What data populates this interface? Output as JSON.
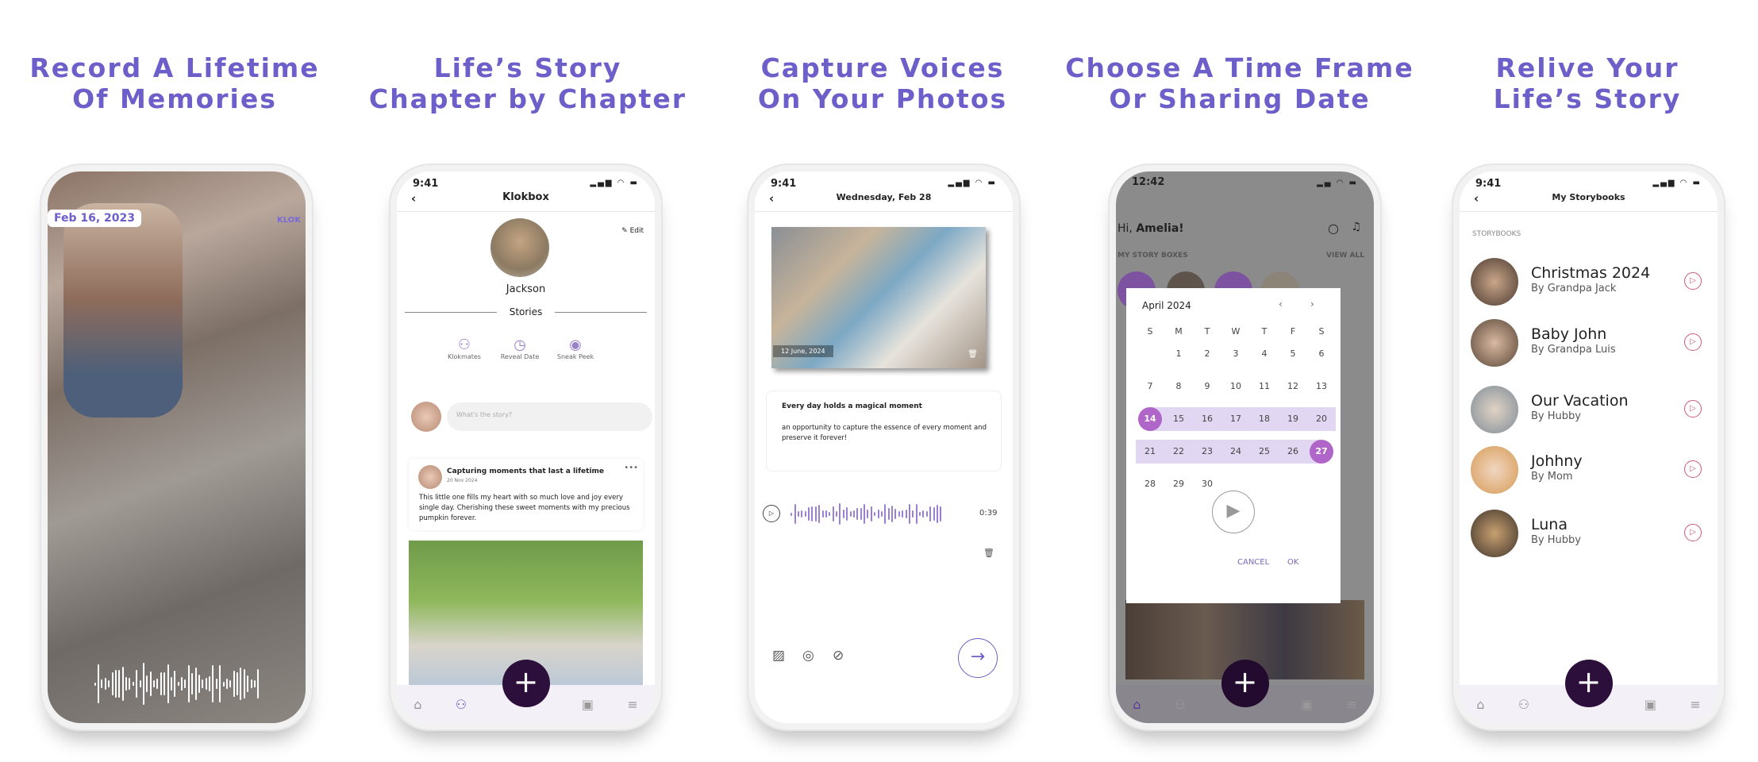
{
  "headlines": [
    {
      "line1": "Record A Lifetime",
      "line2": "Of Memories"
    },
    {
      "line1": "Life’s Story",
      "line2": "Chapter by Chapter"
    },
    {
      "line1": "Capture Voices",
      "line2": "On Your Photos"
    },
    {
      "line1": "Choose A Time Frame",
      "line2": "Or Sharing Date"
    },
    {
      "line1": "Relive Your",
      "line2": "Life’s Story"
    }
  ],
  "colors": {
    "headline": "#6c5fc9",
    "accent": "#b065c9",
    "fab": "#2c0f3a",
    "range": "#e1d7f2"
  },
  "phone1": {
    "date_badge": "Feb 16, 2023",
    "watermark": "KLOK"
  },
  "phone2": {
    "time": "9:41",
    "title": "Klokbox",
    "edit": "Edit",
    "name": "Jackson",
    "section": "Stories",
    "actions": [
      {
        "label": "Klokmates",
        "icon": "people-icon"
      },
      {
        "label": "Reveal Date",
        "icon": "clock-icon"
      },
      {
        "label": "Sneak Peek",
        "icon": "eye-icon"
      }
    ],
    "composer_placeholder": "What's the story?",
    "post": {
      "title": "Capturing moments that last a lifetime",
      "date": "20 Nov 2024",
      "body": "This little one fills my heart with so much love and joy every single day. Cherishing these sweet moments with my precious pumpkin forever."
    }
  },
  "phone3": {
    "time": "9:41",
    "title": "Wednesday, Feb 28",
    "photo_date": "12 June, 2024",
    "card_title": "Every day holds a magical moment",
    "card_body": "an opportunity to capture the essence of every moment and preserve it forever!",
    "duration": "0:39"
  },
  "phone4": {
    "time": "12:42",
    "greeting": "Hi,",
    "user": "Amelia!",
    "section": "MY STORY BOXES",
    "view_all": "VIEW ALL",
    "calendar": {
      "month": "April 2024",
      "weekdays": [
        "S",
        "M",
        "T",
        "W",
        "T",
        "F",
        "S"
      ],
      "first_weekday": 1,
      "days": 30,
      "range_start": 14,
      "range_end": 27,
      "cancel": "CANCEL",
      "ok": "OK"
    }
  },
  "phone5": {
    "time": "9:41",
    "title": "My Storybooks",
    "section": "STORYBOOKS",
    "items": [
      {
        "title": "Christmas 2024",
        "by": "By Grandpa Jack"
      },
      {
        "title": "Baby John",
        "by": "By Grandpa Luis"
      },
      {
        "title": "Our Vacation",
        "by": "By Hubby"
      },
      {
        "title": "Johhny",
        "by": "By Mom"
      },
      {
        "title": "Luna",
        "by": "By Hubby"
      }
    ]
  }
}
